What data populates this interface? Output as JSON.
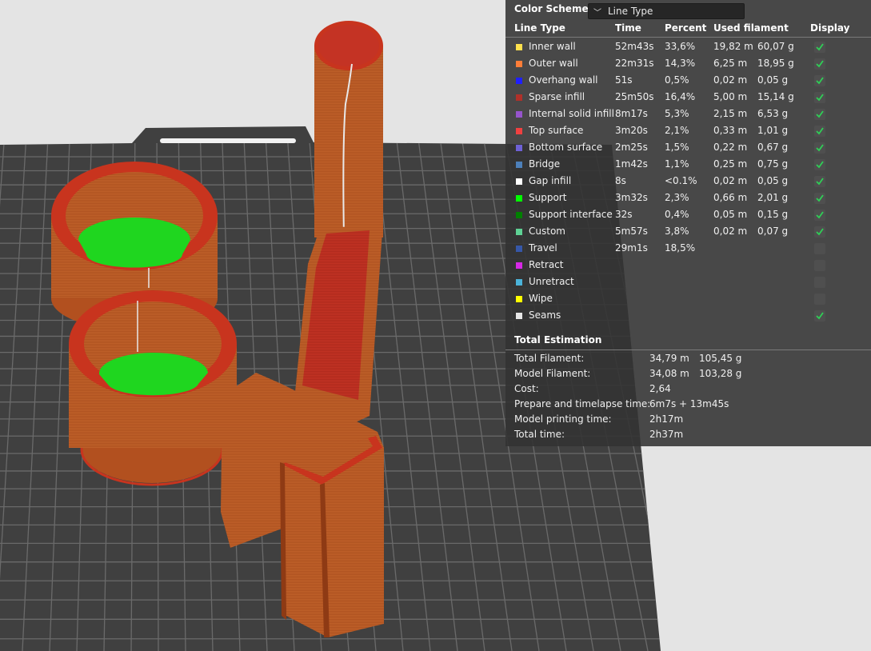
{
  "header": {
    "color_scheme_label": "Color Scheme",
    "color_scheme_value": "Line Type"
  },
  "columns": {
    "line_type": "Line Type",
    "time": "Time",
    "percent": "Percent",
    "used_filament": "Used filament",
    "display": "Display"
  },
  "line_types": [
    {
      "name": "Inner wall",
      "color": "#ffe14d",
      "time": "52m43s",
      "percent": "33,6%",
      "length": "19,82 m",
      "weight": "60,07 g",
      "display": true
    },
    {
      "name": "Outer wall",
      "color": "#ff7d38",
      "time": "22m31s",
      "percent": "14,3%",
      "length": "6,25 m",
      "weight": "18,95 g",
      "display": true
    },
    {
      "name": "Overhang wall",
      "color": "#1f1fff",
      "time": "51s",
      "percent": "0,5%",
      "length": "0,02 m",
      "weight": "0,05 g",
      "display": true
    },
    {
      "name": "Sparse infill",
      "color": "#b03029",
      "time": "25m50s",
      "percent": "16,4%",
      "length": "5,00 m",
      "weight": "15,14 g",
      "display": true
    },
    {
      "name": "Internal solid infill",
      "color": "#9654cc",
      "time": "8m17s",
      "percent": "5,3%",
      "length": "2,15 m",
      "weight": "6,53 g",
      "display": true
    },
    {
      "name": "Top surface",
      "color": "#f04040",
      "time": "3m20s",
      "percent": "2,1%",
      "length": "0,33 m",
      "weight": "1,01 g",
      "display": true
    },
    {
      "name": "Bottom surface",
      "color": "#6e61d6",
      "time": "2m25s",
      "percent": "1,5%",
      "length": "0,22 m",
      "weight": "0,67 g",
      "display": true
    },
    {
      "name": "Bridge",
      "color": "#4d80ba",
      "time": "1m42s",
      "percent": "1,1%",
      "length": "0,25 m",
      "weight": "0,75 g",
      "display": true
    },
    {
      "name": "Gap infill",
      "color": "#ffffff",
      "time": "8s",
      "percent": "<0.1%",
      "length": "0,02 m",
      "weight": "0,05 g",
      "display": true
    },
    {
      "name": "Support",
      "color": "#00ff00",
      "time": "3m32s",
      "percent": "2,3%",
      "length": "0,66 m",
      "weight": "2,01 g",
      "display": true
    },
    {
      "name": "Support interface",
      "color": "#008000",
      "time": "32s",
      "percent": "0,4%",
      "length": "0,05 m",
      "weight": "0,15 g",
      "display": true
    },
    {
      "name": "Custom",
      "color": "#5ed194",
      "time": "5m57s",
      "percent": "3,8%",
      "length": "0,02 m",
      "weight": "0,07 g",
      "display": true
    },
    {
      "name": "Travel",
      "color": "#3657a8",
      "time": "29m1s",
      "percent": "18,5%",
      "length": "",
      "weight": "",
      "display": false
    },
    {
      "name": "Retract",
      "color": "#d628e6",
      "time": "",
      "percent": "",
      "length": "",
      "weight": "",
      "display": false
    },
    {
      "name": "Unretract",
      "color": "#4bb3d9",
      "time": "",
      "percent": "",
      "length": "",
      "weight": "",
      "display": false
    },
    {
      "name": "Wipe",
      "color": "#ffff00",
      "time": "",
      "percent": "",
      "length": "",
      "weight": "",
      "display": false
    },
    {
      "name": "Seams",
      "color": "#e6e6e6",
      "time": "",
      "percent": "",
      "length": "",
      "weight": "",
      "display": true
    }
  ],
  "total_estimation": {
    "title": "Total Estimation",
    "rows": [
      {
        "label": "Total Filament:",
        "value1": "34,79 m",
        "value2": "105,45 g"
      },
      {
        "label": "Model Filament:",
        "value1": "34,08 m",
        "value2": "103,28 g"
      },
      {
        "label": "Cost:",
        "value1": "2,64",
        "value2": ""
      },
      {
        "label": "Prepare and timelapse time:",
        "value1": "6m7s + 13m45s",
        "value2": ""
      },
      {
        "label": "Model printing time:",
        "value1": "2h17m",
        "value2": ""
      },
      {
        "label": "Total time:",
        "value1": "2h37m",
        "value2": ""
      }
    ]
  },
  "colors": {
    "background": "#e4e4e4",
    "plate": "#404040",
    "grid": "#6a6a6a",
    "model": "#c0612a",
    "model_edge": "#c8341e",
    "support": "#18d818",
    "check": "#2fcf56"
  }
}
